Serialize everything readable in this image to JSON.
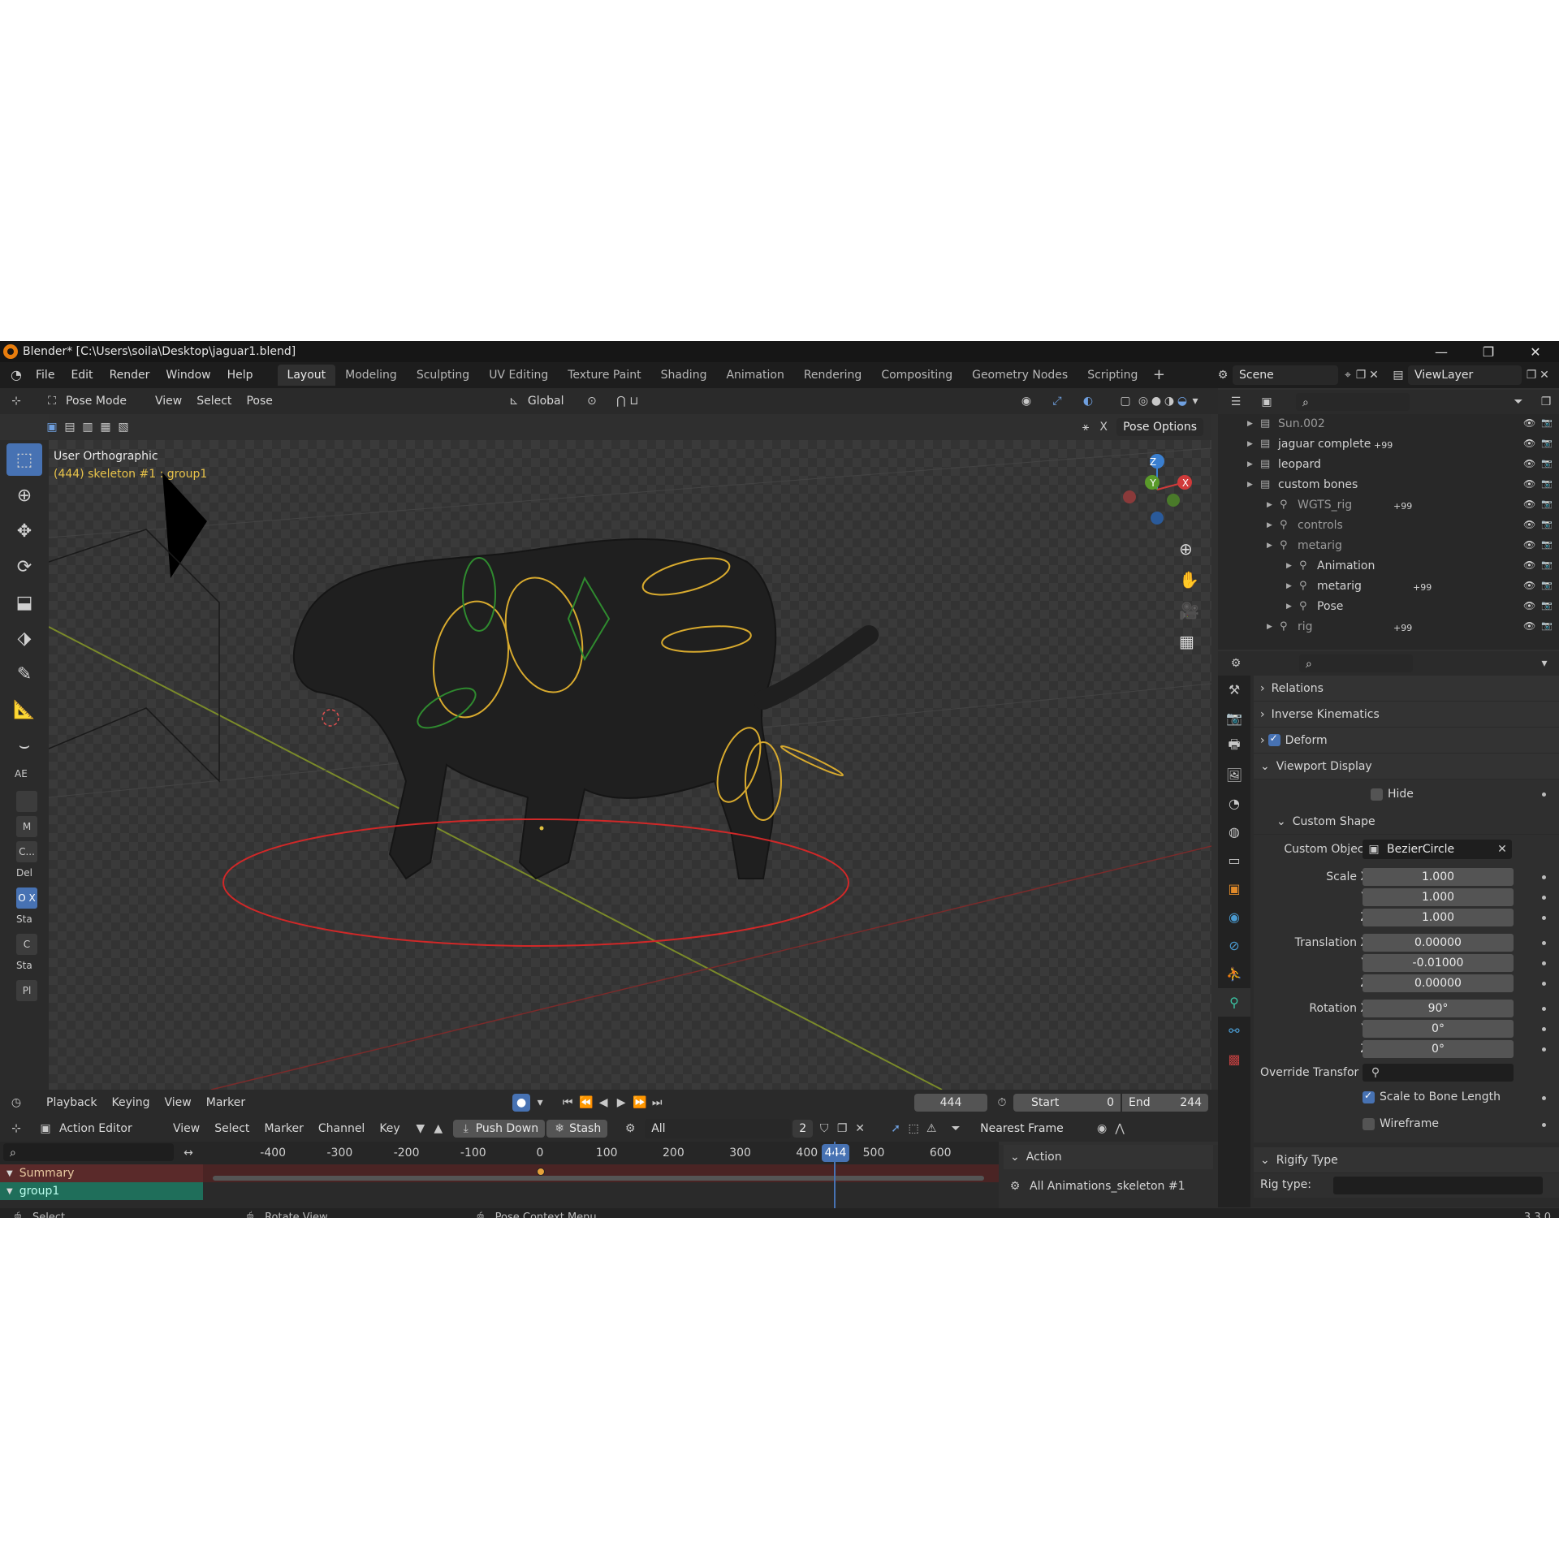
{
  "titlebar": {
    "title": "Blender* [C:\\Users\\soila\\Desktop\\jaguar1.blend]",
    "minimize": "—",
    "restore": "❐",
    "close": "✕"
  },
  "menu": [
    "File",
    "Edit",
    "Render",
    "Window",
    "Help"
  ],
  "workspaces": [
    "Layout",
    "Modeling",
    "Sculpting",
    "UV Editing",
    "Texture Paint",
    "Shading",
    "Animation",
    "Rendering",
    "Compositing",
    "Geometry Nodes",
    "Scripting"
  ],
  "scene": {
    "name": "Scene",
    "viewlayer": "ViewLayer"
  },
  "viewport_header": {
    "mode": "Pose Mode",
    "menus": [
      "View",
      "Select",
      "Pose"
    ],
    "orientation": "Global",
    "pose_options": "Pose Options"
  },
  "viewport": {
    "view_name": "User Orthographic",
    "context": "(444) skeleton #1 : group1"
  },
  "toolbar_side": [
    "M",
    "C...",
    "Del",
    "O X",
    "Sta",
    "C",
    "Sta",
    "Pl"
  ],
  "toolbar_side_label": "AE",
  "gizmo": {
    "z": "Z",
    "y": "Y",
    "x": "X"
  },
  "outliner": {
    "items": [
      {
        "label": "Sun.002",
        "indent": 0,
        "dim": true
      },
      {
        "label": "jaguar complete",
        "indent": 0,
        "badge": "+99"
      },
      {
        "label": "leopard",
        "indent": 0
      },
      {
        "label": "custom bones",
        "indent": 0
      },
      {
        "label": "WGTS_rig",
        "indent": 1,
        "dim": true,
        "badge": "+99"
      },
      {
        "label": "controls",
        "indent": 1,
        "dim": true
      },
      {
        "label": "metarig",
        "indent": 1,
        "dim": true
      },
      {
        "label": "Animation",
        "indent": 2
      },
      {
        "label": "metarig",
        "indent": 2,
        "badge": "+99"
      },
      {
        "label": "Pose",
        "indent": 2
      },
      {
        "label": "rig",
        "indent": 1,
        "dim": true,
        "badge": "+99"
      }
    ]
  },
  "properties": {
    "sections_top": [
      "Relations",
      "Inverse Kinematics",
      "Deform"
    ],
    "viewport_display": "Viewport Display",
    "hide_label": "Hide",
    "custom_shape": "Custom Shape",
    "custom_object_label": "Custom Object",
    "custom_object_value": "BezierCircle",
    "scale": {
      "label": "Scale X",
      "x": "1.000",
      "y": "1.000",
      "z": "1.000"
    },
    "translation": {
      "label": "Translation X",
      "x": "0.00000",
      "y": "-0.01000",
      "z": "0.00000"
    },
    "rotation": {
      "label": "Rotation X",
      "x": "90°",
      "y": "0°",
      "z": "0°"
    },
    "axis_y": "Y",
    "axis_z": "Z",
    "override_label": "Override Transfor",
    "scale_to_bone": "Scale to Bone Length",
    "wireframe": "Wireframe",
    "rigify_type": "Rigify Type",
    "rig_type_label": "Rig type:"
  },
  "timeline": {
    "menus": [
      "Playback",
      "Keying",
      "View",
      "Marker"
    ],
    "current_frame": "444",
    "start_label": "Start",
    "start": "0",
    "end_label": "End",
    "end": "244"
  },
  "action_editor": {
    "mode": "Action Editor",
    "menus": [
      "View",
      "Select",
      "Marker",
      "Channel",
      "Key"
    ],
    "push_down": "Push Down",
    "stash": "Stash",
    "action_name": "All Animations_skeleton #1",
    "users": "2",
    "snap": "Nearest Frame"
  },
  "ruler": {
    "ticks": [
      "-400",
      "-300",
      "-200",
      "-100",
      "0",
      "100",
      "200",
      "300",
      "400",
      "500",
      "600"
    ],
    "current": "444"
  },
  "dopesheet": {
    "summary": "Summary",
    "group": "group1"
  },
  "action_panel": {
    "title": "Action",
    "name": "All Animations_skeleton #1"
  },
  "status": {
    "select": "Select",
    "rotate": "Rotate View",
    "context": "Pose Context Menu",
    "version": "3.3.0"
  },
  "colors": {
    "accent": "#4772b3",
    "bone_yellow": "#e0b030",
    "bone_green": "#3c9a3c",
    "bone_red": "#d02828",
    "context_text": "#e8c34a"
  }
}
